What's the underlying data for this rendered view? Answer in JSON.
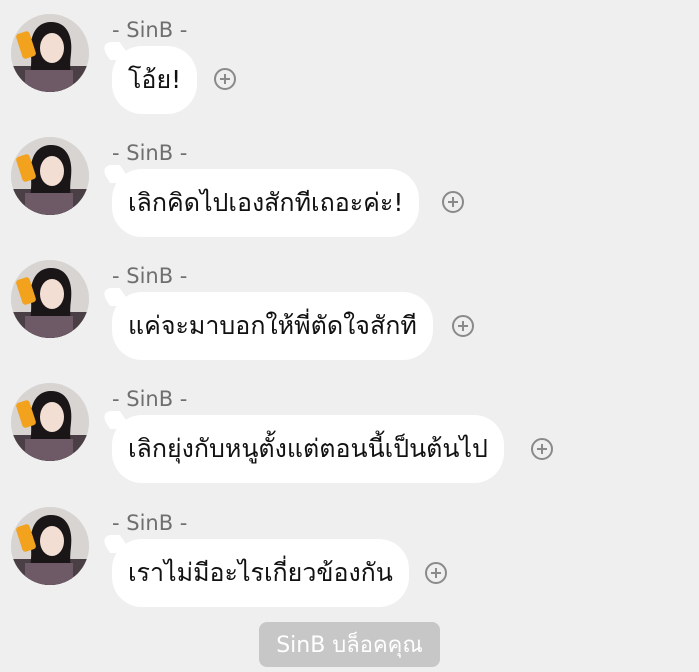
{
  "conversation": {
    "messages": [
      {
        "sender": "- SinB -",
        "text": "โอ้ย!",
        "avatar": "avatar"
      },
      {
        "sender": "- SinB -",
        "text": "เลิกคิดไปเองสักทีเถอะค่ะ!",
        "avatar": "avatar"
      },
      {
        "sender": "- SinB -",
        "text": "แค่จะมาบอกให้พี่ตัดใจสักที",
        "avatar": "avatar"
      },
      {
        "sender": "- SinB -",
        "text": "เลิกยุ่งกับหนูตั้งแต่ตอนนี้เป็นต้นไป",
        "avatar": "avatar"
      },
      {
        "sender": "- SinB -",
        "text": "เราไม่มีอะไรเกี่ยวข้องกัน",
        "avatar": "avatar"
      }
    ],
    "add_icon": "plus-circle-icon",
    "block_notice": "SinB บล็อคคุณ"
  },
  "colors": {
    "background": "#efefef",
    "bubble": "#ffffff",
    "sender_text": "#6f6f6f",
    "notice_bg": "#c7c7c7"
  }
}
